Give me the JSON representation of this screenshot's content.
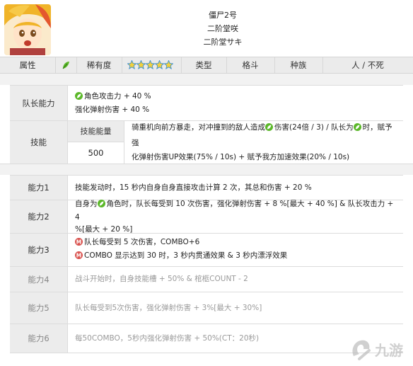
{
  "header": {
    "name": "僵尸2号",
    "name_cn": "二阶堂咲",
    "name_jp": "二阶堂サキ"
  },
  "infobar": {
    "attr_label": "属性",
    "rarity_label": "稀有度",
    "rarity_stars": 5,
    "type_label": "类型",
    "type_value": "格斗",
    "race_label": "种族",
    "race_value": "人 / 不死"
  },
  "leader": {
    "label": "队长能力",
    "line1": "角色攻击力 + 40 %",
    "line2": "强化弹射伤害 + 40 %"
  },
  "skill": {
    "label": "技能",
    "energy_label": "技能能量",
    "energy_value": "500",
    "text_a": "骑重机向前方暴走，对冲撞到的敌人造成",
    "text_b": "伤害(24倍 / 3) / 队长为",
    "text_c": "时，赋予强",
    "text_d": "化弹射伤害UP效果(75% / 10s) + 赋予我方加速效果(20% / 10s)"
  },
  "abilities": [
    {
      "label": "能力1",
      "text": "技能发动时，15 秒内自身自身直接攻击计算 2 次，其总和伤害 + 20 %"
    },
    {
      "label": "能力2",
      "text_a": "自身为",
      "text_b": "角色时，队长每受到 10 次伤害，强化弹射伤害 + 8 %[最大 + 40 %] & 队长攻击力 + 4",
      "text_c": "%[最大 + 20 %]"
    },
    {
      "label": "能力3",
      "line1": "队长每受到 5 次伤害，COMBO+6",
      "line2": "COMBO 显示达到 30 时，3 秒内贯通效果 & 3 秒内漂浮效果"
    },
    {
      "label": "能力4",
      "text": "战斗开始时，自身技能槽 + 50% & 棺柩COUNT - 2"
    },
    {
      "label": "能力5",
      "text": "队长每受到5次伤害，强化弹射伤害 + 3%[最大 + 30%]"
    },
    {
      "label": "能力6",
      "text": "每50COMBO，5秒内强化弹射伤害 + 50%(CT：20秒)"
    }
  ],
  "colors": {
    "green_attr": "#5cb82a",
    "combo_red": "#d9534f",
    "label_bg": "#ececec"
  },
  "watermark": "九游"
}
